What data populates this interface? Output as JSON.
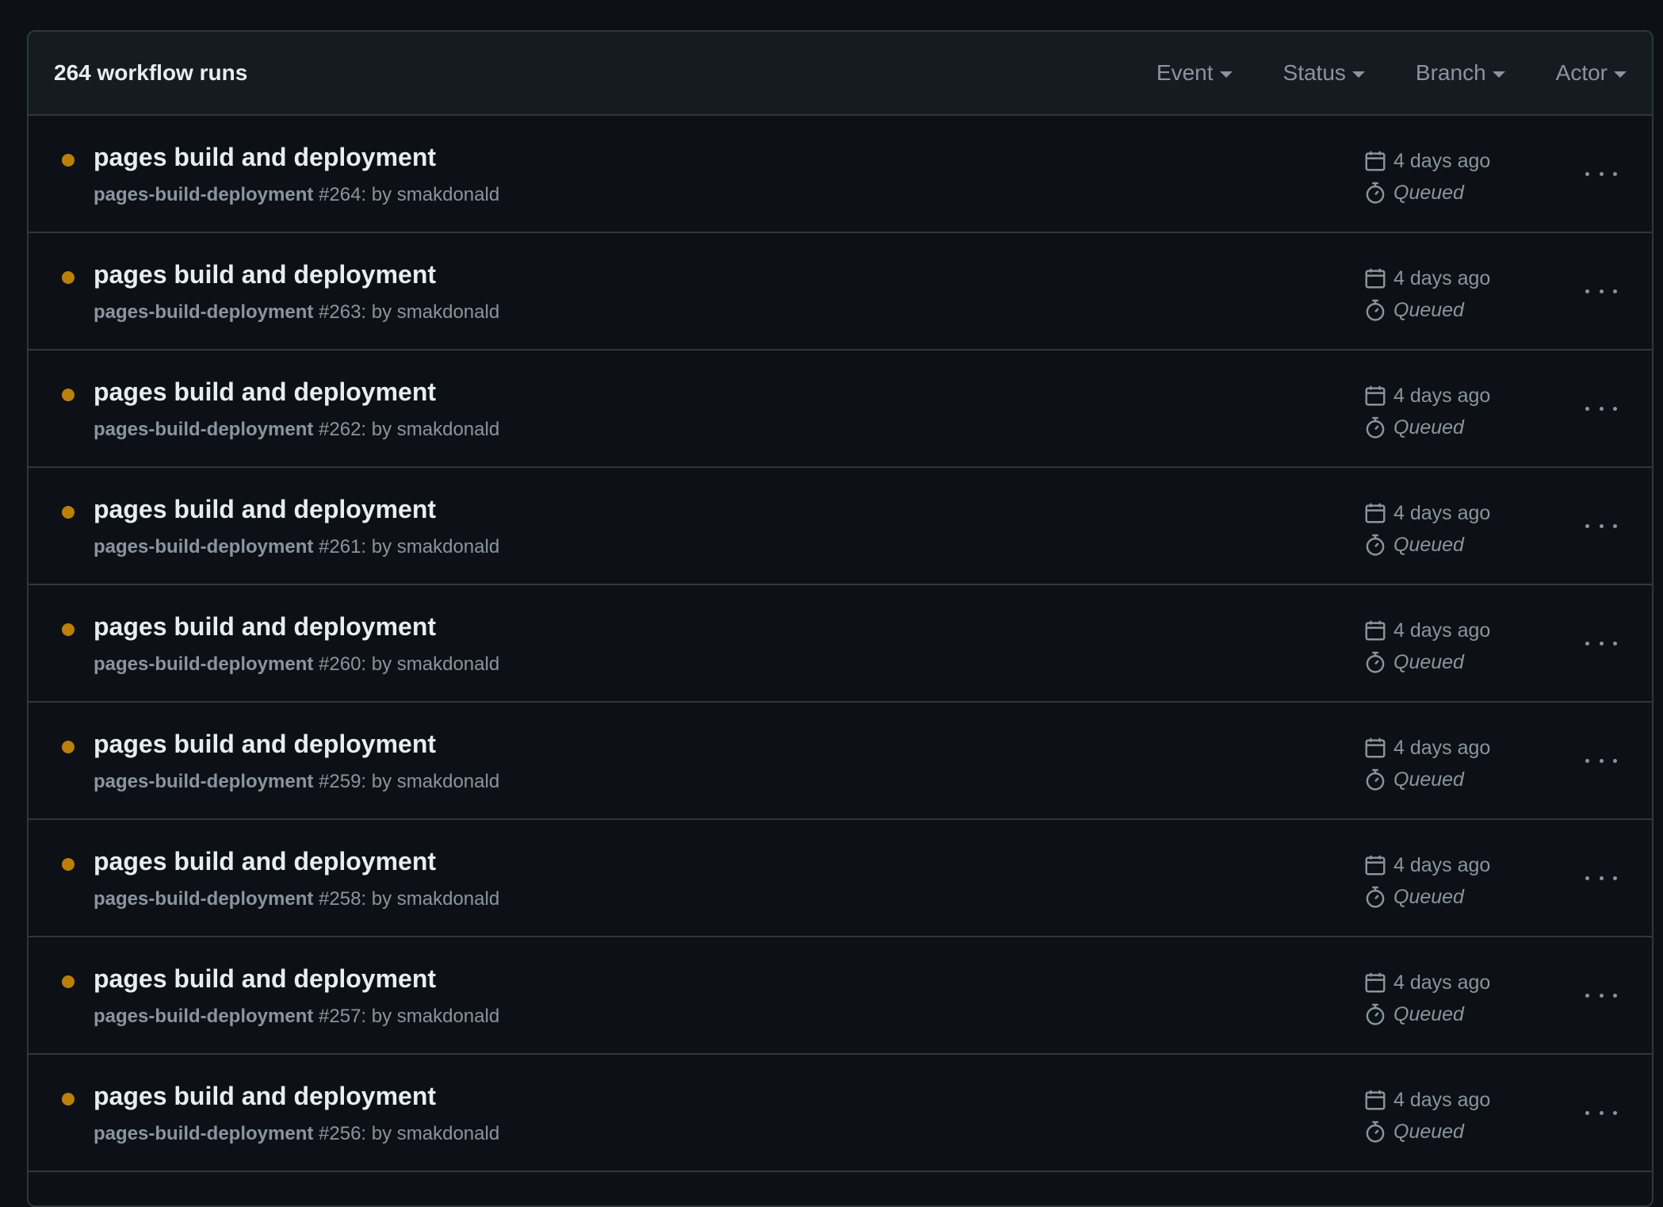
{
  "header": {
    "run_count": "264 workflow runs",
    "filters": [
      "Event",
      "Status",
      "Branch",
      "Actor"
    ]
  },
  "colors": {
    "queued_dot": "#bb8009",
    "background": "#0d1117",
    "header_bg": "#161b22",
    "border": "#30363d",
    "muted_text": "#8b949e"
  },
  "icons": {
    "date": "calendar-icon",
    "duration": "stopwatch-icon",
    "menu": "kebab-menu-icon"
  },
  "runs": [
    {
      "title": "pages build and deployment",
      "workflow": "pages-build-deployment",
      "detail": " #264: by smakdonald",
      "time": "4 days ago",
      "status": "Queued"
    },
    {
      "title": "pages build and deployment",
      "workflow": "pages-build-deployment",
      "detail": " #263: by smakdonald",
      "time": "4 days ago",
      "status": "Queued"
    },
    {
      "title": "pages build and deployment",
      "workflow": "pages-build-deployment",
      "detail": " #262: by smakdonald",
      "time": "4 days ago",
      "status": "Queued"
    },
    {
      "title": "pages build and deployment",
      "workflow": "pages-build-deployment",
      "detail": " #261: by smakdonald",
      "time": "4 days ago",
      "status": "Queued"
    },
    {
      "title": "pages build and deployment",
      "workflow": "pages-build-deployment",
      "detail": " #260: by smakdonald",
      "time": "4 days ago",
      "status": "Queued"
    },
    {
      "title": "pages build and deployment",
      "workflow": "pages-build-deployment",
      "detail": " #259: by smakdonald",
      "time": "4 days ago",
      "status": "Queued"
    },
    {
      "title": "pages build and deployment",
      "workflow": "pages-build-deployment",
      "detail": " #258: by smakdonald",
      "time": "4 days ago",
      "status": "Queued"
    },
    {
      "title": "pages build and deployment",
      "workflow": "pages-build-deployment",
      "detail": " #257: by smakdonald",
      "time": "4 days ago",
      "status": "Queued"
    },
    {
      "title": "pages build and deployment",
      "workflow": "pages-build-deployment",
      "detail": " #256: by smakdonald",
      "time": "4 days ago",
      "status": "Queued"
    }
  ]
}
